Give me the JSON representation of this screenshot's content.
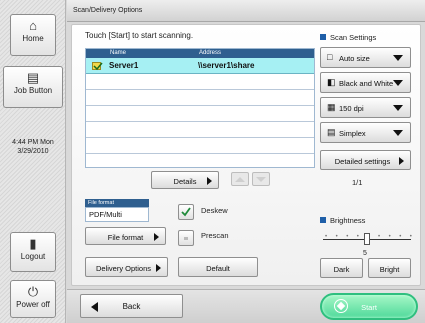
{
  "sidebar": {
    "home_label": "Home",
    "job_button_label": "Job Button",
    "clock_time": "4:44 PM  Mon",
    "clock_date": "3/29/2010",
    "logout_label": "Logout",
    "power_off_label": "Power off"
  },
  "header": {
    "title": "Scan/Delivery Options"
  },
  "main": {
    "prompt": "Touch [Start] to start scanning.",
    "list": {
      "columns": [
        "Name",
        "Address"
      ],
      "rows": [
        {
          "name": "Server1",
          "address": "\\\\server1\\share",
          "selected": true
        }
      ]
    },
    "details_label": "Details",
    "page_indicator": "1/1",
    "file_format": {
      "header": "File format",
      "value": "PDF/Multi",
      "button_label": "File format"
    },
    "delivery_options_label": "Delivery Options",
    "deskew_label": "Deskew",
    "prescan_label": "Prescan",
    "default_label": "Default"
  },
  "scan_settings": {
    "title": "Scan Settings",
    "size": "Auto size",
    "color": "Black and White",
    "resolution": "150 dpi",
    "sides": "Simplex",
    "detailed_label": "Detailed settings"
  },
  "brightness": {
    "title": "Brightness",
    "value": "5",
    "level_fraction": 0.5,
    "dark_label": "Dark",
    "bright_label": "Bright"
  },
  "footer": {
    "back_label": "Back",
    "start_label": "Start"
  },
  "colors": {
    "accent": "#2f5f8f",
    "selection": "#a6f0f3",
    "start": "#4fd99a"
  }
}
